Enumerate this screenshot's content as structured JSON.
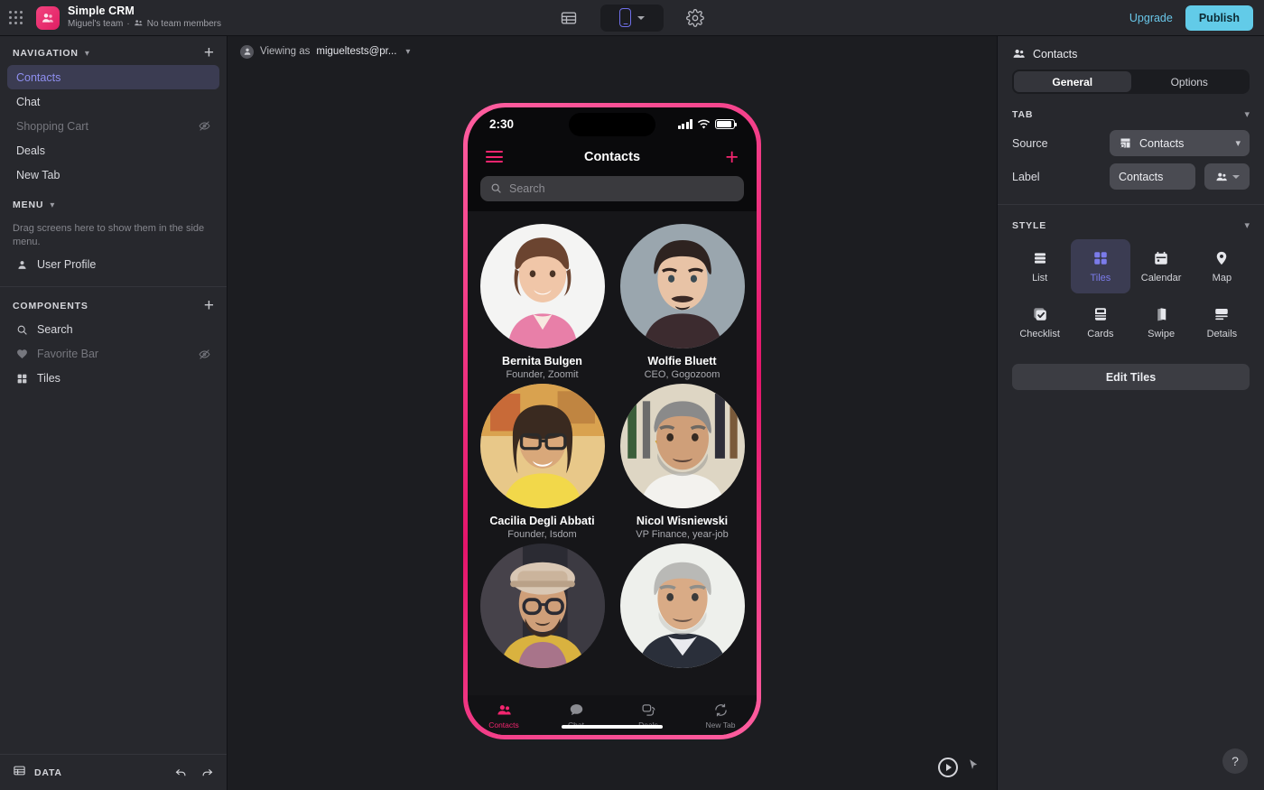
{
  "topbar": {
    "app_title": "Simple CRM",
    "app_subtitle_team": "Miguel's team",
    "app_subtitle_sep": "·",
    "app_subtitle_members": "No team members",
    "upgrade_label": "Upgrade",
    "publish_label": "Publish",
    "publish_color": "#62cbe8",
    "upgrade_color": "#69c6e8",
    "brand_color": "#e01e63"
  },
  "sidebar": {
    "navigation": {
      "title": "NAVIGATION",
      "items": [
        {
          "label": "Contacts",
          "active": true,
          "hidden": false
        },
        {
          "label": "Chat",
          "active": false,
          "hidden": false
        },
        {
          "label": "Shopping Cart",
          "active": false,
          "hidden": true
        },
        {
          "label": "Deals",
          "active": false,
          "hidden": false
        },
        {
          "label": "New Tab",
          "active": false,
          "hidden": false
        }
      ]
    },
    "menu": {
      "title": "MENU",
      "note": "Drag screens here to show them in the side menu.",
      "items": [
        {
          "label": "User Profile",
          "icon": "person-icon"
        }
      ]
    },
    "components": {
      "title": "COMPONENTS",
      "items": [
        {
          "label": "Search",
          "icon": "search-icon",
          "hidden": false
        },
        {
          "label": "Favorite Bar",
          "icon": "heart-icon",
          "hidden": true
        },
        {
          "label": "Tiles",
          "icon": "tiles-icon",
          "hidden": false
        }
      ]
    },
    "footer": {
      "data_label": "DATA"
    }
  },
  "canvas": {
    "viewing_prefix": "Viewing as",
    "viewing_user": "migueltests@pr...",
    "active_color": "#8f8ff0"
  },
  "phone": {
    "status": {
      "time": "2:30"
    },
    "nav": {
      "title": "Contacts"
    },
    "search": {
      "placeholder": "Search"
    },
    "accent": "#f3256f",
    "contacts": [
      {
        "name": "Bernita Bulgen",
        "role": "Founder, Zoomit",
        "photo": "woman-pink-blazer"
      },
      {
        "name": "Wolfie Bluett",
        "role": "CEO, Gogozoom",
        "photo": "young-man-gray"
      },
      {
        "name": "Cacilia Degli Abbati",
        "role": "Founder, Isdom",
        "photo": "woman-glasses-yellow"
      },
      {
        "name": "Nicol Wisniewski",
        "role": "VP Finance, year-job",
        "photo": "older-man-workshop"
      },
      {
        "name": "",
        "role": "",
        "photo": "man-hat-glasses"
      },
      {
        "name": "",
        "role": "",
        "photo": "gray-hair-suit"
      }
    ],
    "tabs": [
      {
        "label": "Contacts",
        "icon": "people-icon",
        "active": true
      },
      {
        "label": "Chat",
        "icon": "chat-icon",
        "active": false
      },
      {
        "label": "Deals",
        "icon": "deals-icon",
        "active": false
      },
      {
        "label": "New Tab",
        "icon": "refresh-icon",
        "active": false
      }
    ]
  },
  "right_panel": {
    "header_title": "Contacts",
    "tabs": [
      {
        "label": "General",
        "active": true
      },
      {
        "label": "Options",
        "active": false
      }
    ],
    "tab_section": {
      "title": "TAB",
      "source_label": "Source",
      "source_value": "Contacts",
      "label_label": "Label",
      "label_value": "Contacts"
    },
    "style_section": {
      "title": "STYLE",
      "options": [
        {
          "label": "List",
          "icon": "list-icon",
          "active": false
        },
        {
          "label": "Tiles",
          "icon": "tiles-icon",
          "active": true
        },
        {
          "label": "Calendar",
          "icon": "calendar-icon",
          "active": false
        },
        {
          "label": "Map",
          "icon": "map-pin-icon",
          "active": false
        },
        {
          "label": "Checklist",
          "icon": "checklist-icon",
          "active": false
        },
        {
          "label": "Cards",
          "icon": "cards-icon",
          "active": false
        },
        {
          "label": "Swipe",
          "icon": "swipe-icon",
          "active": false
        },
        {
          "label": "Details",
          "icon": "details-icon",
          "active": false
        }
      ],
      "edit_button": "Edit Tiles",
      "active_color": "#7b7bea"
    },
    "help_label": "?"
  }
}
